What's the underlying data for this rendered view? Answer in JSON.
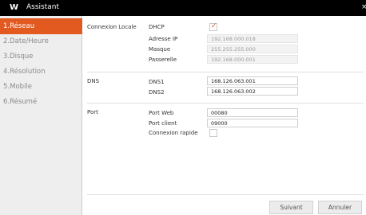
{
  "window": {
    "logo_letter": "W",
    "title": "Assistant",
    "close_glyph": "×"
  },
  "sidebar": {
    "items": [
      {
        "label": "1.Réseau"
      },
      {
        "label": "2.Date/Heure"
      },
      {
        "label": "3.Disque"
      },
      {
        "label": "4.Résolution"
      },
      {
        "label": "5.Mobile"
      },
      {
        "label": "6.Résumé"
      }
    ],
    "active_index": 0
  },
  "connexion": {
    "section_label": "Connexion Locale",
    "dhcp_label": "DHCP",
    "dhcp_checked": true,
    "check_glyph": "✓",
    "ip_label": "Adresse IP",
    "ip_value": "192.168.000.018",
    "mask_label": "Masque",
    "mask_value": "255.255.255.000",
    "gateway_label": "Passerelle",
    "gateway_value": "192.168.000.001"
  },
  "dns": {
    "section_label": "DNS",
    "dns1_label": "DNS1",
    "dns1_value": "168.126.063.001",
    "dns2_label": "DNS2",
    "dns2_value": "168.126.063.002"
  },
  "port": {
    "section_label": "Port",
    "web_label": "Port Web",
    "web_value": "00080",
    "client_label": "Port client",
    "client_value": "09000",
    "fast_label": "Connexion rapide",
    "fast_checked": false
  },
  "footer": {
    "next_label": "Suivant",
    "cancel_label": "Annuler"
  },
  "colors": {
    "accent": "#e25a20",
    "titlebar": "#000000",
    "sidebar_bg": "#eeeeee"
  },
  "icons": {
    "check": "check-icon",
    "close": "close-icon",
    "logo": "logo-icon"
  }
}
